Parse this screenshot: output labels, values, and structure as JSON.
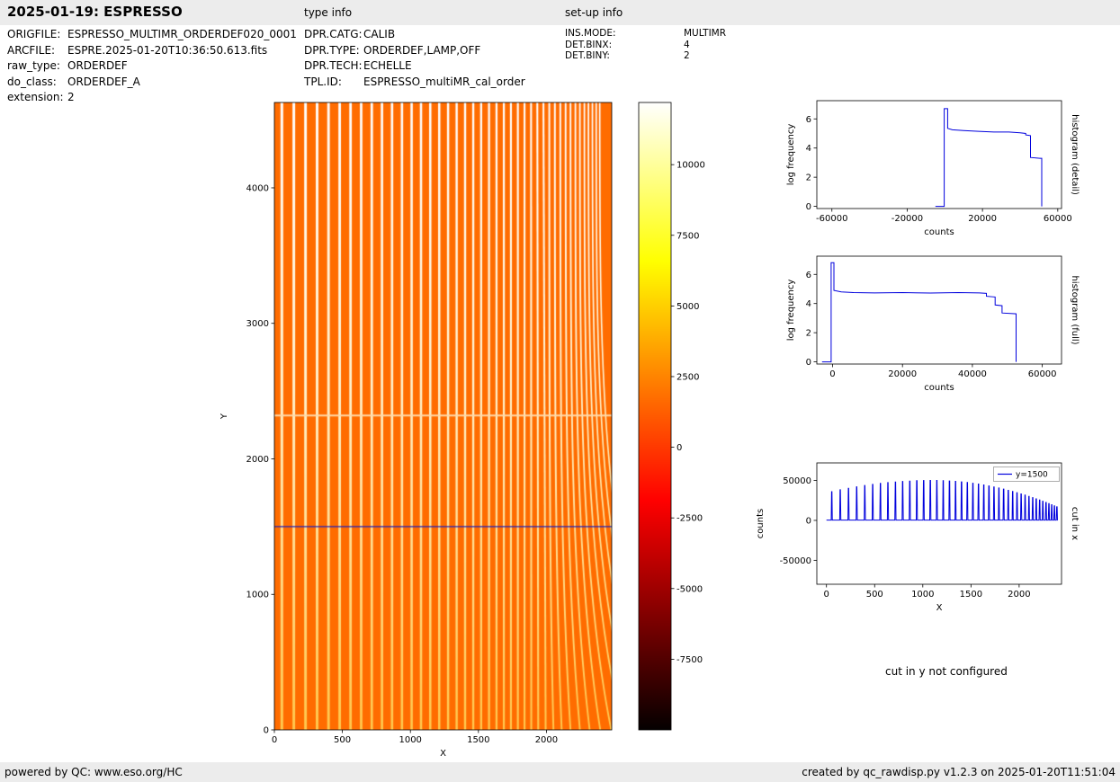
{
  "header": {
    "title": "2025-01-19: ESPRESSO",
    "type_info_label": "type info",
    "setup_info_label": "set-up info"
  },
  "file_info": [
    {
      "key": "ORIGFILE:",
      "value": "ESPRESSO_MULTIMR_ORDERDEF020_0001"
    },
    {
      "key": "ARCFILE:",
      "value": "ESPRE.2025-01-20T10:36:50.613.fits"
    },
    {
      "key": "raw_type:",
      "value": "ORDERDEF"
    },
    {
      "key": "do_class:",
      "value": "ORDERDEF_A"
    },
    {
      "key": "extension:",
      "value": "2"
    }
  ],
  "type_info": [
    {
      "key": "DPR.CATG:",
      "value": "CALIB"
    },
    {
      "key": "DPR.TYPE:",
      "value": "ORDERDEF,LAMP,OFF"
    },
    {
      "key": "DPR.TECH:",
      "value": "ECHELLE"
    },
    {
      "key": "TPL.ID:",
      "value": "ESPRESSO_multiMR_cal_order"
    }
  ],
  "setup_info": [
    {
      "key": "INS.MODE:",
      "value": "MULTIMR"
    },
    {
      "key": "DET.BINX:",
      "value": "4"
    },
    {
      "key": "DET.BINY:",
      "value": "2"
    }
  ],
  "notes": {
    "cut_y": "cut in y not configured"
  },
  "footer": {
    "left": "powered by QC: www.eso.org/HC",
    "right": "created by qc_rawdisp.py v1.2.3 on 2025-01-20T11:51:04"
  },
  "chart_data": [
    {
      "id": "raw-frame",
      "type": "heatmap",
      "description": "ESPRESSO MULTIMR ORDERDEF raw frame: bright vertical echelle order traces on orange background, traces compress and curve toward high X; light detector gap line and blue cut line overlay",
      "xlabel": "X",
      "ylabel": "Y",
      "xlim": [
        0,
        2480
      ],
      "ylim": [
        0,
        4630
      ],
      "xticks": [
        0,
        500,
        1000,
        1500,
        2000
      ],
      "yticks": [
        0,
        1000,
        2000,
        3000,
        4000
      ],
      "background_color": "#ff6c00",
      "trace_color_top": "#ffffff",
      "trace_color_bottom": "#ffc84d",
      "order_trace_x": [
        55,
        143,
        229,
        314,
        398,
        480,
        560,
        638,
        716,
        791,
        865,
        938,
        1009,
        1078,
        1146,
        1212,
        1277,
        1340,
        1402,
        1462,
        1520,
        1578,
        1633,
        1687,
        1739,
        1790,
        1839,
        1887,
        1933,
        1978,
        2021,
        2062,
        2102,
        2141,
        2177,
        2213,
        2246,
        2279,
        2309,
        2338,
        2366,
        2392
      ],
      "detector_gap_y": 2320,
      "overlay_line": {
        "y": 1500,
        "color": "#2222bb"
      },
      "colorbar": {
        "cmap": "hot",
        "vmin": -10000,
        "vmax": 12200,
        "ticks": [
          10000,
          7500,
          5000,
          2500,
          0,
          -2500,
          -5000,
          -7500
        ]
      }
    },
    {
      "id": "histogram-detail",
      "type": "line",
      "title_right": "histogram (detail)",
      "xlabel": "counts",
      "ylabel": "log frequency",
      "xlim": [
        -68000,
        62000
      ],
      "ylim": [
        -0.15,
        7.25
      ],
      "xticks": [
        -60000,
        -20000,
        20000,
        60000
      ],
      "yticks": [
        0,
        2,
        4,
        6
      ],
      "line_color": "#0000dd",
      "x": [
        -5000,
        -300,
        -300,
        1500,
        1500,
        4000,
        10000,
        18000,
        26000,
        34000,
        40000,
        43000,
        43000,
        45500,
        45500,
        50500,
        51500,
        51500
      ],
      "y": [
        0,
        0,
        6.7,
        6.7,
        5.35,
        5.25,
        5.2,
        5.15,
        5.1,
        5.1,
        5.05,
        5.0,
        4.9,
        4.85,
        3.35,
        3.3,
        3.3,
        0
      ]
    },
    {
      "id": "histogram-full",
      "type": "line",
      "title_right": "histogram (full)",
      "xlabel": "counts",
      "ylabel": "log frequency",
      "xlim": [
        -4500,
        65500
      ],
      "ylim": [
        -0.15,
        7.25
      ],
      "xticks": [
        0,
        20000,
        40000,
        60000
      ],
      "yticks": [
        0,
        2,
        4,
        6
      ],
      "line_color": "#0000dd",
      "x": [
        -3000,
        -400,
        -400,
        400,
        400,
        2500,
        6000,
        12000,
        20000,
        28000,
        36000,
        42000,
        44000,
        44000,
        46500,
        46500,
        48500,
        48500,
        52500,
        52500
      ],
      "y": [
        0,
        0,
        6.8,
        6.8,
        4.9,
        4.8,
        4.75,
        4.73,
        4.75,
        4.72,
        4.75,
        4.73,
        4.7,
        4.5,
        4.45,
        3.9,
        3.85,
        3.35,
        3.3,
        0
      ]
    },
    {
      "id": "cut-in-x",
      "type": "line",
      "title_right": "cut in x",
      "legend": [
        "y=1500"
      ],
      "xlabel": "X",
      "ylabel": "counts",
      "xlim": [
        -100,
        2440
      ],
      "ylim": [
        -80000,
        72000
      ],
      "xticks": [
        0,
        500,
        1000,
        1500,
        2000
      ],
      "yticks": [
        -50000,
        0,
        50000
      ],
      "line_color": "#0000dd",
      "baseline": 400,
      "spike_x": [
        55,
        143,
        229,
        314,
        398,
        480,
        560,
        638,
        716,
        791,
        865,
        938,
        1009,
        1078,
        1146,
        1212,
        1277,
        1340,
        1402,
        1462,
        1520,
        1578,
        1633,
        1687,
        1739,
        1790,
        1839,
        1887,
        1933,
        1978,
        2021,
        2062,
        2102,
        2141,
        2177,
        2213,
        2246,
        2279,
        2309,
        2338,
        2366,
        2392
      ],
      "spike_height": [
        36000,
        38300,
        40300,
        42100,
        43700,
        45100,
        46300,
        47300,
        48100,
        48800,
        49300,
        49700,
        49900,
        50000,
        50000,
        49800,
        49400,
        48900,
        48200,
        47400,
        46500,
        45500,
        44400,
        43200,
        41900,
        40600,
        39200,
        37700,
        36300,
        34700,
        33200,
        31700,
        30100,
        28500,
        27000,
        25500,
        24000,
        22500,
        21100,
        19700,
        18300,
        16900
      ]
    }
  ]
}
